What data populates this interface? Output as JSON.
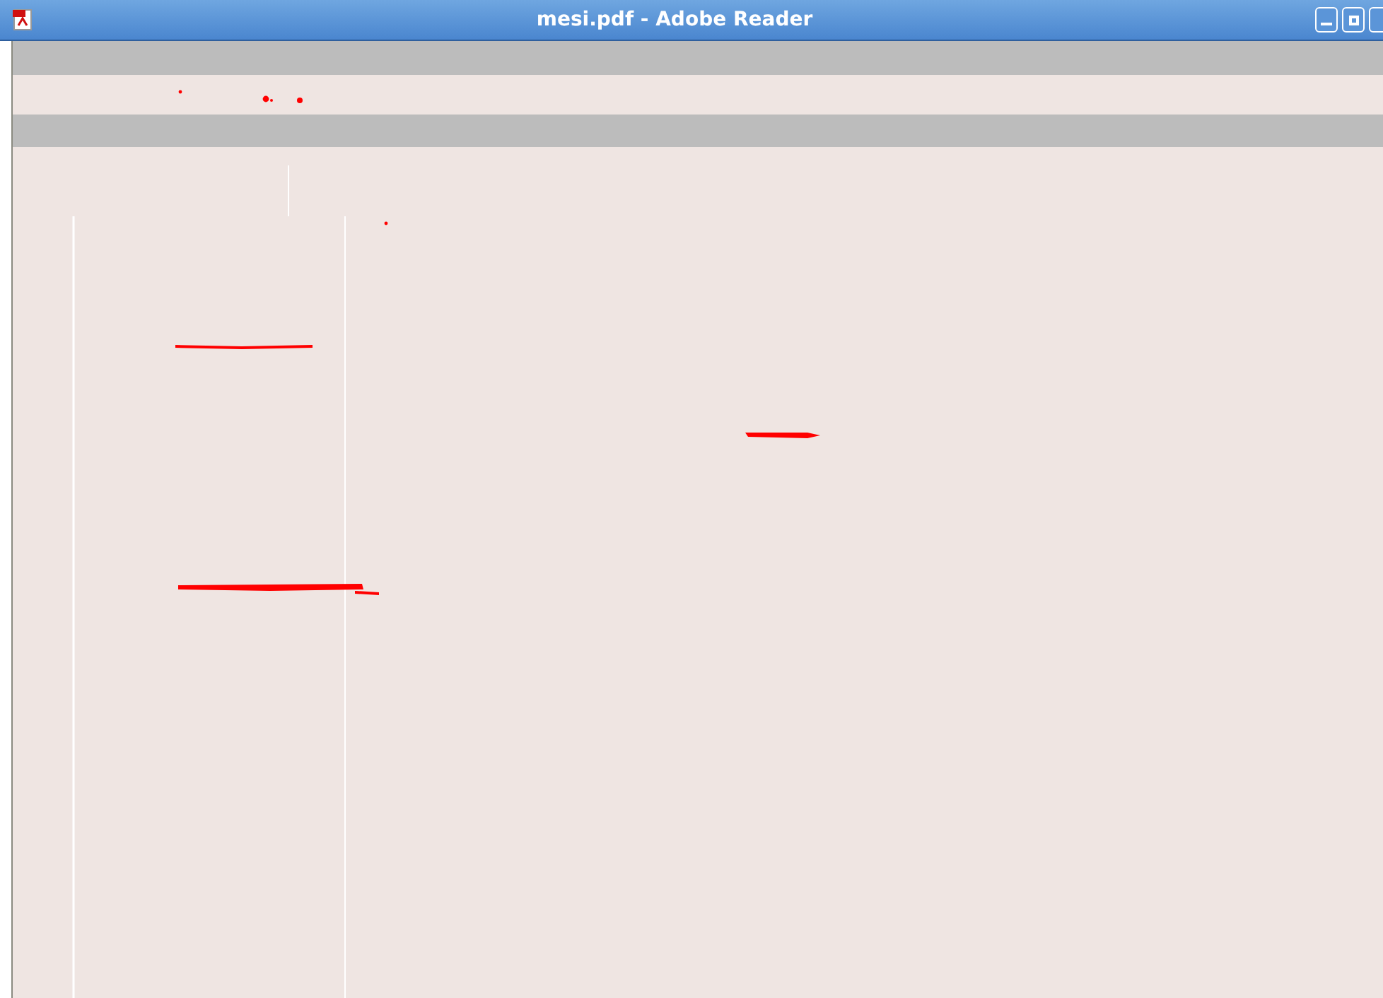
{
  "window": {
    "title": "mesi.pdf - Adobe Reader"
  }
}
